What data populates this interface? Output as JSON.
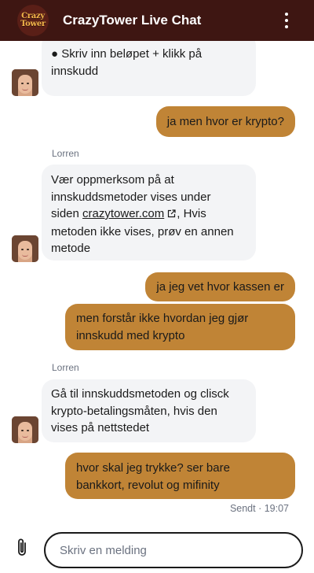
{
  "header": {
    "logo_line1": "Crazy",
    "logo_line2": "Tower",
    "title": "CrazyTower Live Chat",
    "menu_icon": "more-vertical-icon"
  },
  "colors": {
    "header_bg": "#3e1612",
    "user_bubble": "#c08436",
    "agent_bubble": "#f3f4f6"
  },
  "messages": [
    {
      "from": "agent",
      "text": "● Skriv inn beløpet + klikk på\ninnskudd"
    },
    {
      "from": "user",
      "text": "ja men hvor er krypto?"
    },
    {
      "from": "agent",
      "sender": "Lorren",
      "text_before": "Vær oppmerksom på at\ninnskuddsmetoder vises under\nsiden ",
      "link": "crazytower.com",
      "text_after": ", Hvis\nmetoden ikke vises, prøv en annen\nmetode"
    },
    {
      "from": "user",
      "text": "ja jeg vet hvor kassen er"
    },
    {
      "from": "user",
      "text": "men forstår ikke hvordan jeg gjør\ninnskudd med krypto"
    },
    {
      "from": "agent",
      "sender": "Lorren",
      "text": "Gå til innskuddsmetoden og clisck\nkrypto-betalingsmåten, hvis den\nvises på nettstedet"
    },
    {
      "from": "user",
      "text": "hvor skal jeg trykke? ser bare\nbankkort, revolut og mifinity"
    }
  ],
  "status": "Sendt · 19:07",
  "composer": {
    "placeholder": "Skriv en melding",
    "attach_icon": "paperclip-icon"
  }
}
